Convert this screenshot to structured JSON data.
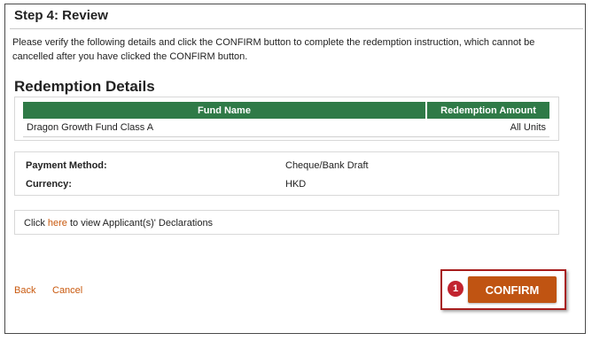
{
  "header": {
    "step_title": "Step 4: Review",
    "intro": "Please verify the following details and click the CONFIRM button to complete the redemption instruction, which cannot be cancelled after you have clicked the CONFIRM button."
  },
  "redemption": {
    "section_title": "Redemption Details",
    "columns": [
      "Fund Name",
      "Redemption Amount"
    ],
    "rows": [
      {
        "fund_name": "Dragon Growth Fund Class A",
        "amount": "All Units"
      }
    ]
  },
  "payment": {
    "method_label": "Payment Method:",
    "method_value": "Cheque/Bank Draft",
    "currency_label": "Currency:",
    "currency_value": "HKD"
  },
  "declaration": {
    "prefix": "Click",
    "link": "here",
    "suffix": "to view Applicant(s)' Declarations"
  },
  "actions": {
    "back": "Back",
    "cancel": "Cancel",
    "confirm": "CONFIRM",
    "badge": "1"
  },
  "colors": {
    "table_header": "#2f7a47",
    "link": "#c9590e",
    "confirm_button": "#c05412",
    "highlight_border": "#a71d1d",
    "badge": "#c2232f"
  }
}
